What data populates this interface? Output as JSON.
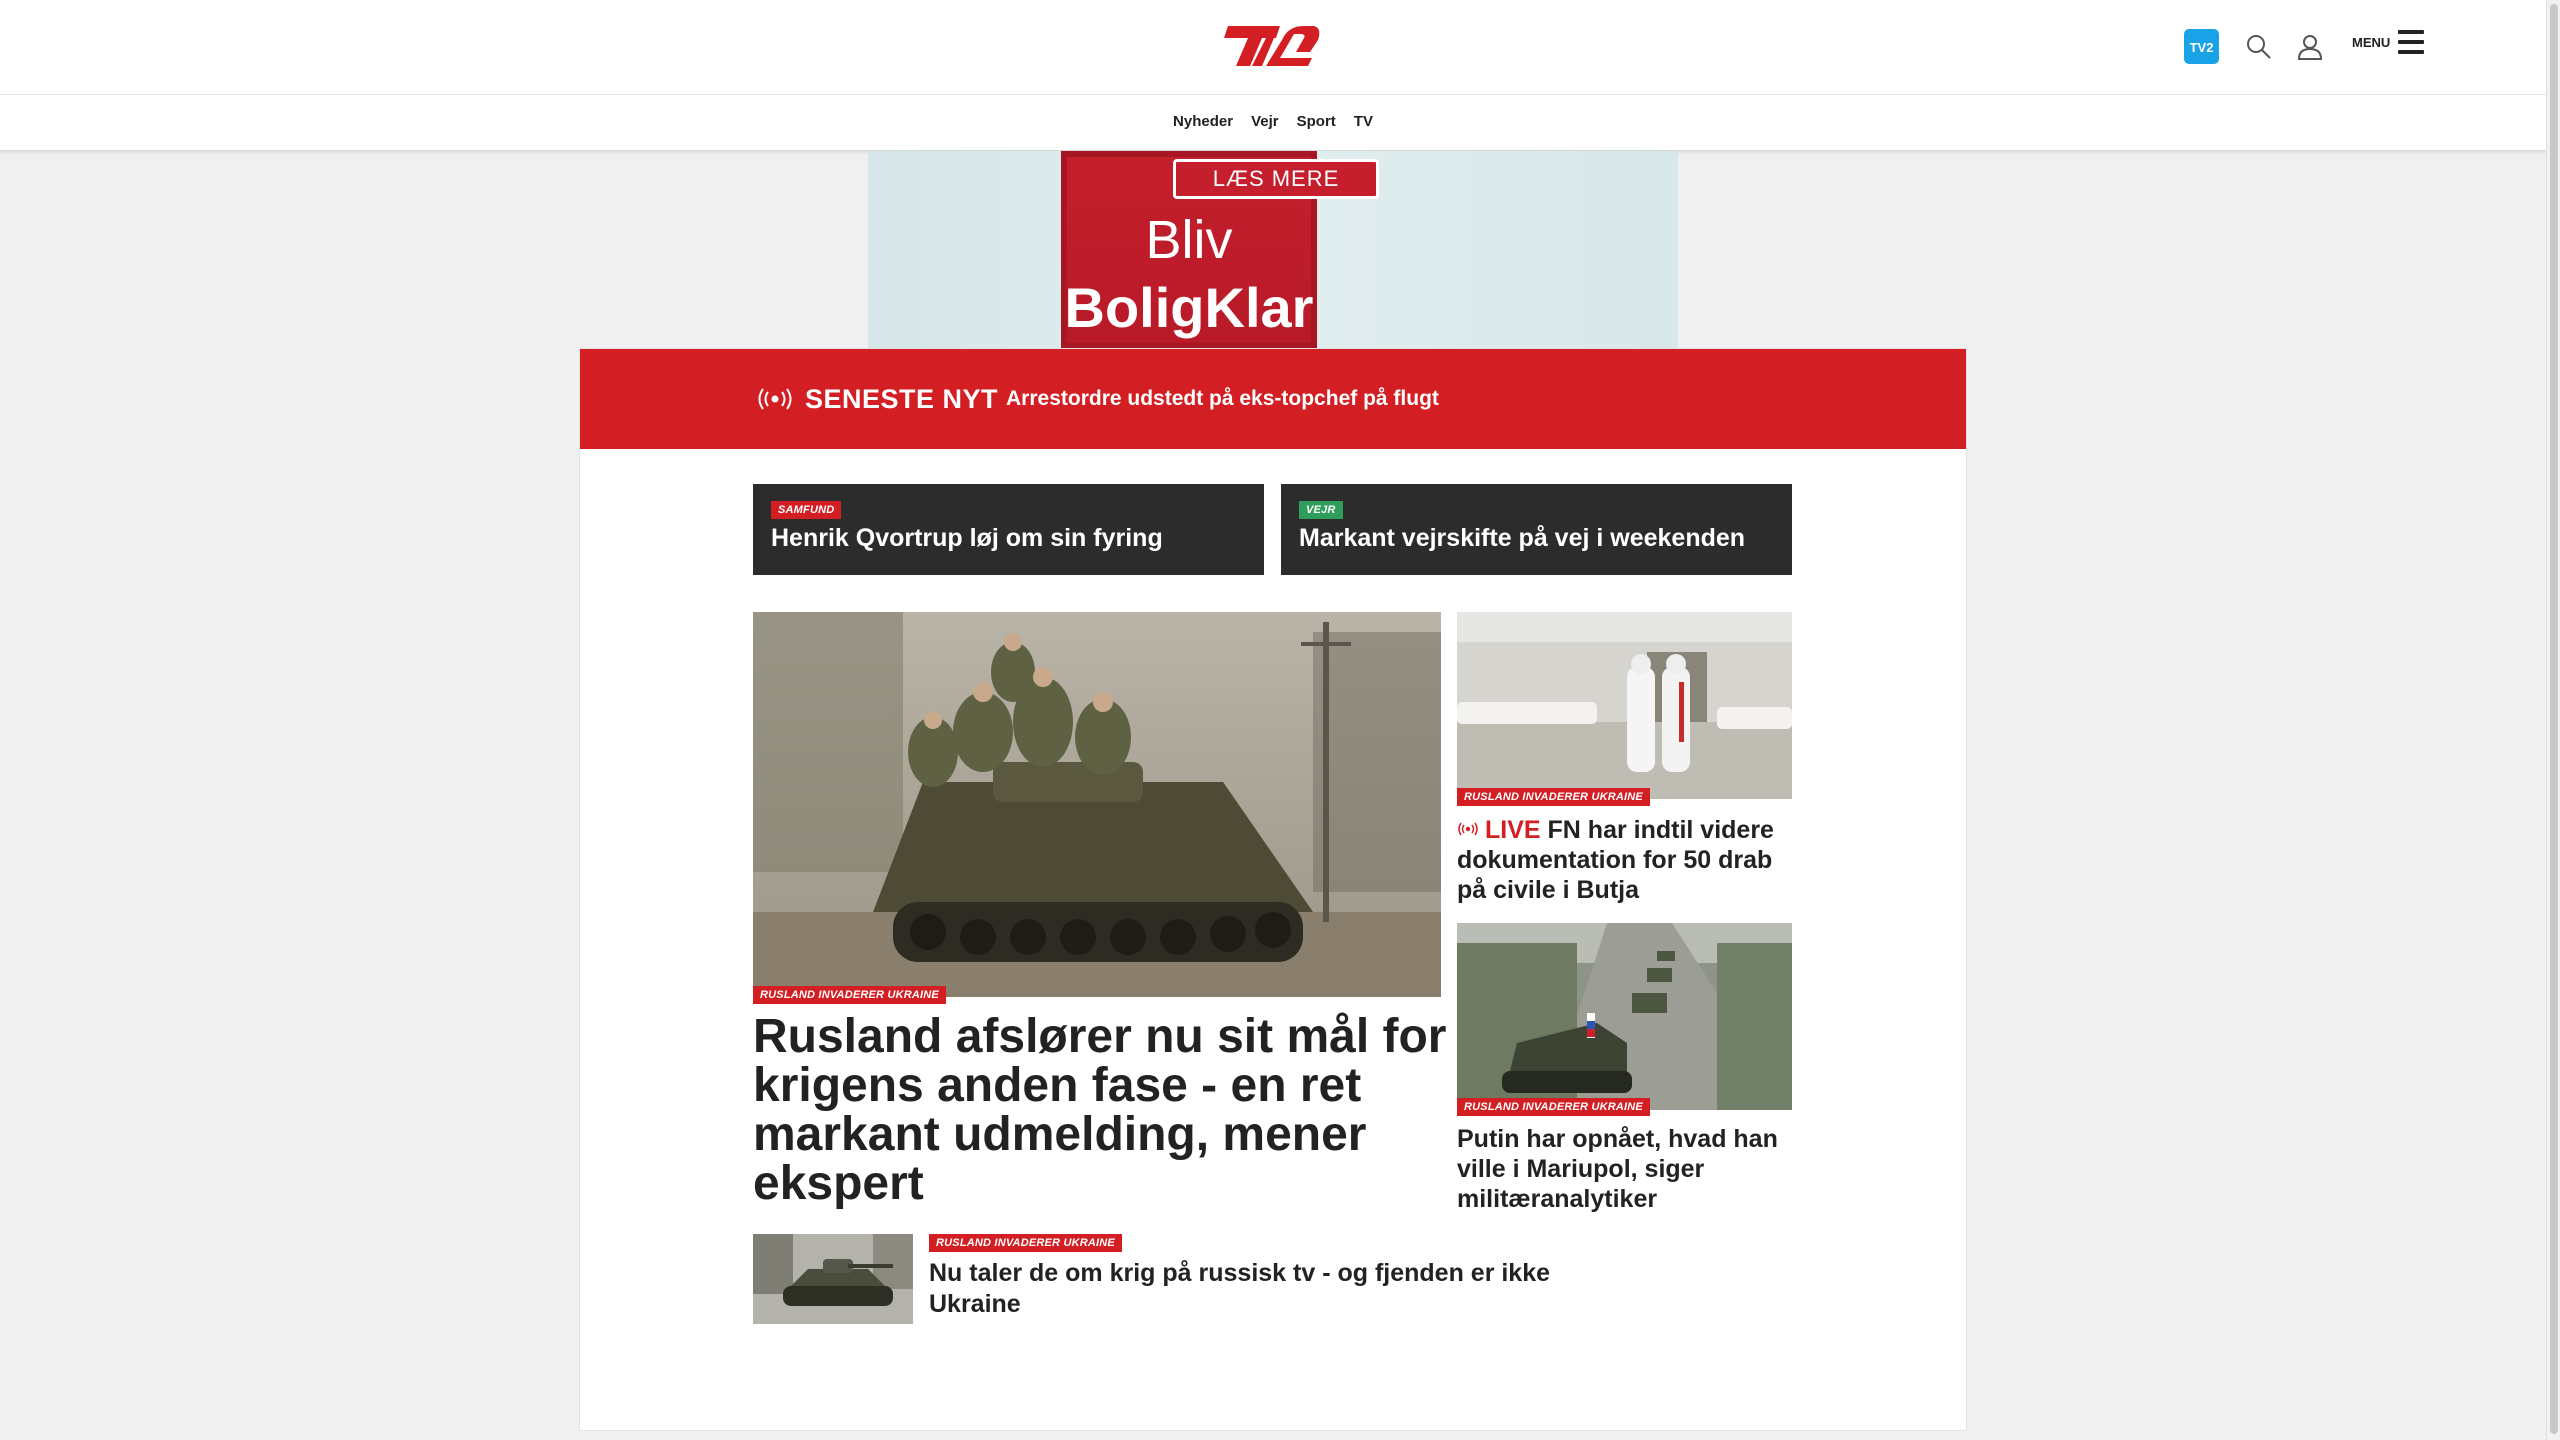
{
  "header": {
    "logo_text": "TV2",
    "menu_label": "MENU",
    "nav": [
      "Nyheder",
      "Vejr",
      "Sport",
      "TV"
    ]
  },
  "ad": {
    "button": "LÆS MERE",
    "line1": "Bliv",
    "line2": "BoligKlar"
  },
  "breaking": {
    "label": "SENESTE NYT",
    "text": "Arrestordre udstedt på eks-topchef på flugt"
  },
  "strips": [
    {
      "tag": "SAMFUND",
      "title": "Henrik Qvortrup løj om sin fyring"
    },
    {
      "tag": "VEJR",
      "title": "Markant vejrskifte på vej i weekenden"
    }
  ],
  "main_story": {
    "tag": "RUSLAND INVADERER UKRAINE",
    "title": "Rusland afslører nu sit mål for krigens anden fase - en ret markant udmelding, mener ekspert"
  },
  "side_stories": [
    {
      "tag": "RUSLAND INVADERER UKRAINE",
      "live": "LIVE",
      "title": "FN har indtil videre dokumentation for 50 drab på civile i Butja"
    },
    {
      "tag": "RUSLAND INVADERER UKRAINE",
      "title": "Putin har opnået, hvad han ville i Mariupol, siger militæranalytiker"
    }
  ],
  "small_story": {
    "tag": "RUSLAND INVADERER UKRAINE",
    "title": "Nu taler de om krig på russisk tv - og fjenden er ikke Ukraine"
  },
  "colors": {
    "brand_red": "#d31e23",
    "dark_strip": "#2c2c2c",
    "tag_green": "#2f9e5a",
    "tv2_blue": "#1aa2e6"
  },
  "icons": [
    "tv2-play-icon",
    "search-icon",
    "user-icon",
    "hamburger-icon",
    "live-broadcast-icon"
  ]
}
